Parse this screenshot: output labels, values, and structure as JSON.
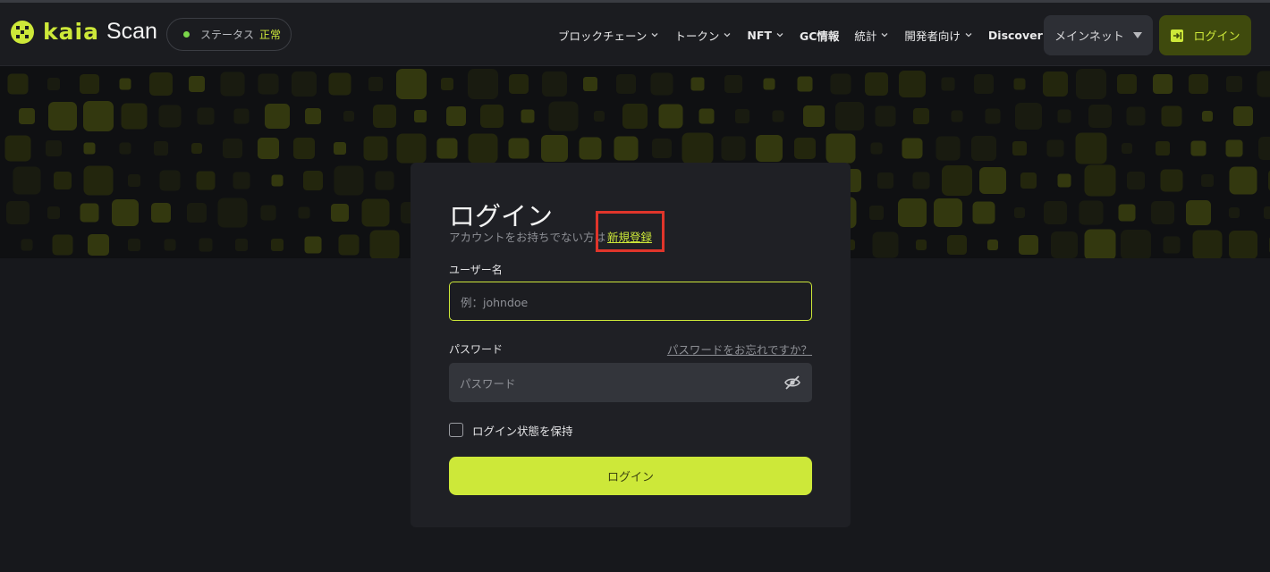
{
  "header": {
    "brand": {
      "kaia": "kaia",
      "scan": "Scan"
    },
    "status": {
      "label": "ステータス",
      "value": "正常"
    },
    "nav": [
      {
        "label": "ブロックチェーン",
        "dropdown": true
      },
      {
        "label": "トークン",
        "dropdown": true
      },
      {
        "label": "NFT",
        "dropdown": true
      },
      {
        "label": "GC情報",
        "dropdown": false
      },
      {
        "label": "統計",
        "dropdown": true
      },
      {
        "label": "開発者向け",
        "dropdown": true
      },
      {
        "label": "Discover",
        "dropdown": false
      }
    ],
    "network": "メインネット",
    "login": "ログイン"
  },
  "login_card": {
    "title": "ログイン",
    "signup_prompt": "アカウントをお持ちでない方は",
    "signup_link": "新規登録",
    "username_label": "ユーザー名",
    "username_placeholder": "例：johndoe",
    "password_label": "パスワード",
    "forgot_link": "パスワードをお忘れですか？",
    "password_placeholder": "パスワード",
    "remember_label": "ログイン状態を保持",
    "remember_checked": false,
    "submit_label": "ログイン"
  },
  "colors": {
    "accent": "#cde839",
    "background": "#17181c",
    "card": "#1f2025",
    "highlight": "#e0352b",
    "status_dot": "#7bd64a"
  },
  "icons": [
    "kaia-logo-icon",
    "status-dot-icon",
    "chevron-down-icon",
    "caret-down-icon",
    "login-arrow-icon",
    "eye-off-icon"
  ]
}
